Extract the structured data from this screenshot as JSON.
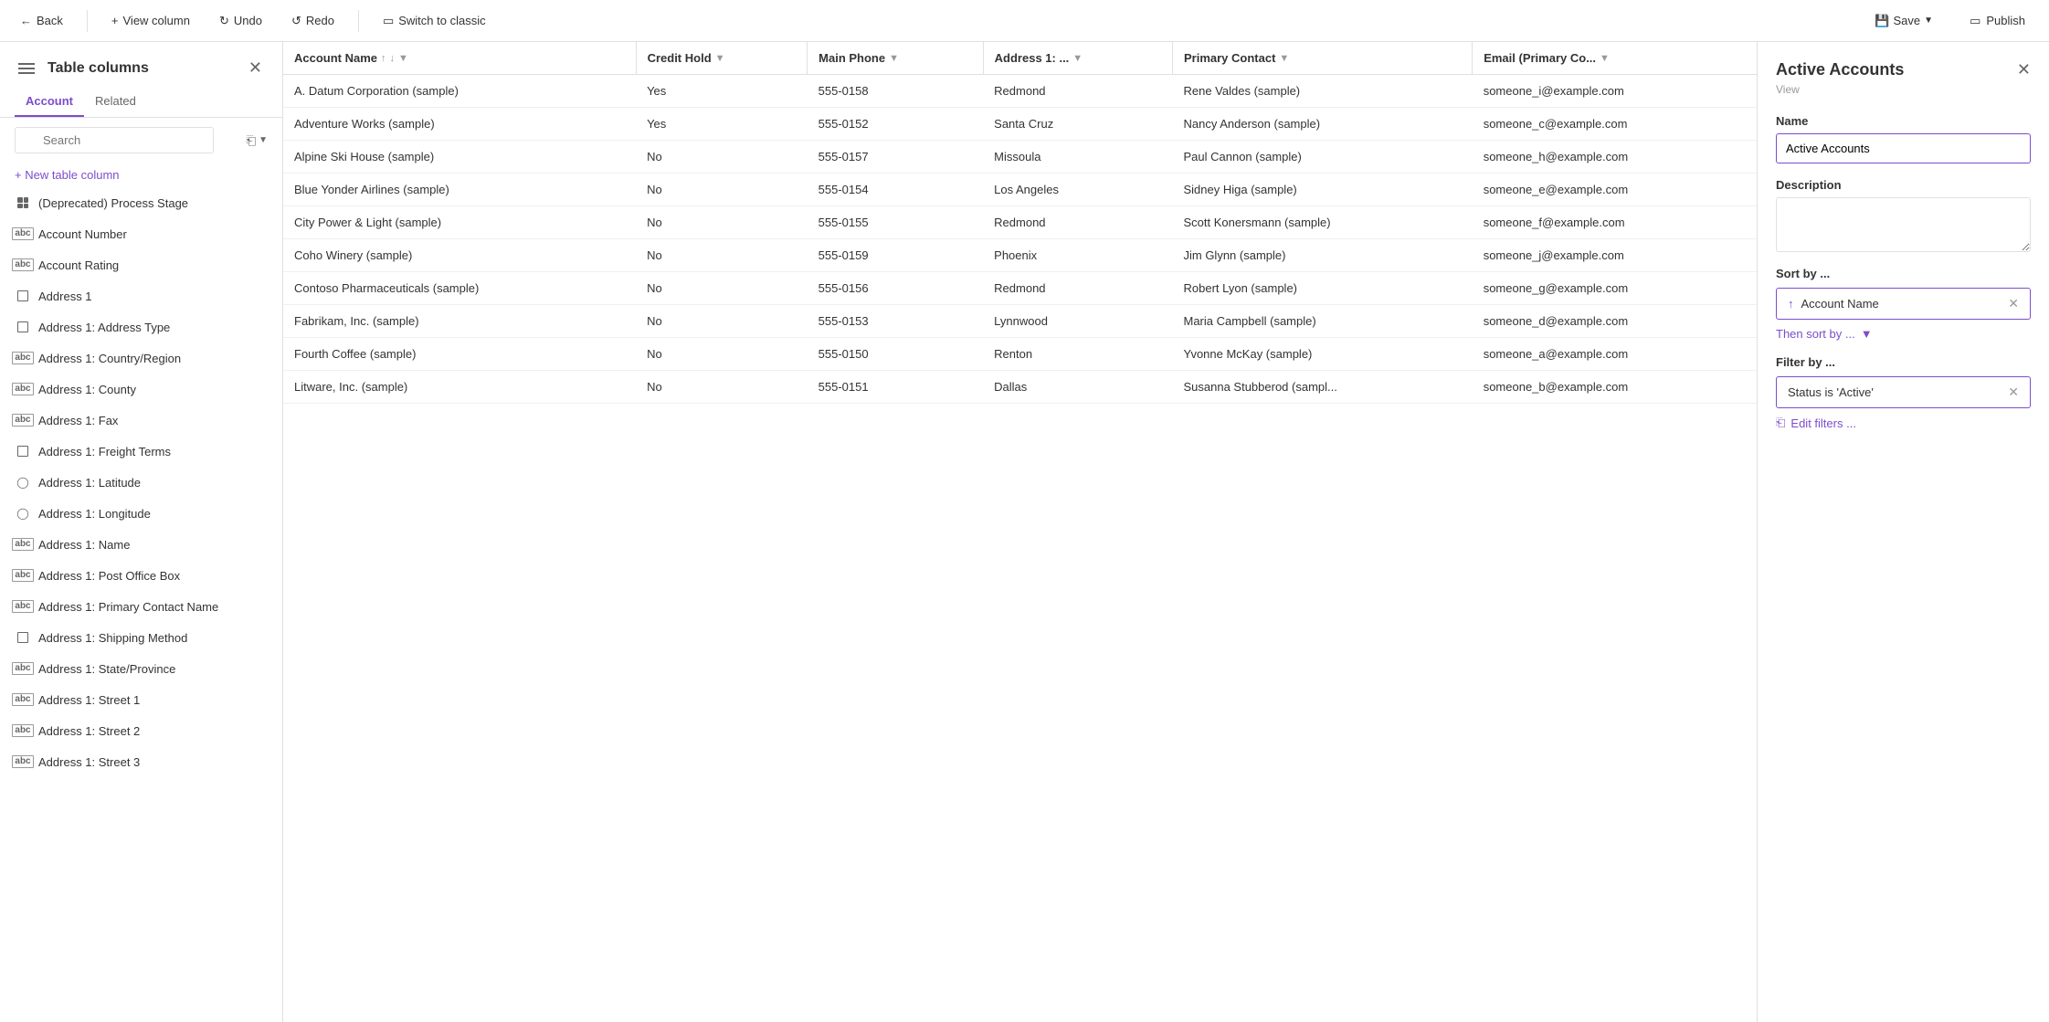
{
  "topbar": {
    "back_label": "Back",
    "view_column_label": "View column",
    "undo_label": "Undo",
    "redo_label": "Redo",
    "switch_label": "Switch to classic",
    "save_label": "Save",
    "publish_label": "Publish"
  },
  "left_panel": {
    "title": "Table columns",
    "tab_account": "Account",
    "tab_related": "Related",
    "search_placeholder": "Search",
    "new_column_label": "+ New table column",
    "columns": [
      {
        "id": "deprecated",
        "name": "(Deprecated) Process Stage",
        "icon": "grid"
      },
      {
        "id": "acct_number",
        "name": "Account Number",
        "icon": "abc"
      },
      {
        "id": "acct_rating",
        "name": "Account Rating",
        "icon": "abc"
      },
      {
        "id": "addr1",
        "name": "Address 1",
        "icon": "box"
      },
      {
        "id": "addr1_type",
        "name": "Address 1: Address Type",
        "icon": "box"
      },
      {
        "id": "addr1_country",
        "name": "Address 1: Country/Region",
        "icon": "abc"
      },
      {
        "id": "addr1_county",
        "name": "Address 1: County",
        "icon": "abc"
      },
      {
        "id": "addr1_fax",
        "name": "Address 1: Fax",
        "icon": "abc"
      },
      {
        "id": "addr1_freight",
        "name": "Address 1: Freight Terms",
        "icon": "box"
      },
      {
        "id": "addr1_lat",
        "name": "Address 1: Latitude",
        "icon": "circle"
      },
      {
        "id": "addr1_lon",
        "name": "Address 1: Longitude",
        "icon": "circle"
      },
      {
        "id": "addr1_name",
        "name": "Address 1: Name",
        "icon": "abc"
      },
      {
        "id": "addr1_po",
        "name": "Address 1: Post Office Box",
        "icon": "abc"
      },
      {
        "id": "addr1_primary",
        "name": "Address 1: Primary Contact Name",
        "icon": "abc"
      },
      {
        "id": "addr1_shipping",
        "name": "Address 1: Shipping Method",
        "icon": "box"
      },
      {
        "id": "addr1_state",
        "name": "Address 1: State/Province",
        "icon": "abc"
      },
      {
        "id": "addr1_street1",
        "name": "Address 1: Street 1",
        "icon": "abc"
      },
      {
        "id": "addr1_street2",
        "name": "Address 1: Street 2",
        "icon": "abc"
      },
      {
        "id": "addr1_street3",
        "name": "Address 1: Street 3",
        "icon": "abc"
      }
    ]
  },
  "table": {
    "columns": [
      {
        "id": "account_name",
        "label": "Account Name",
        "sortable": true,
        "filterable": true
      },
      {
        "id": "credit_hold",
        "label": "Credit Hold",
        "sortable": false,
        "filterable": true
      },
      {
        "id": "main_phone",
        "label": "Main Phone",
        "sortable": false,
        "filterable": true
      },
      {
        "id": "address1",
        "label": "Address 1: ...",
        "sortable": false,
        "filterable": true
      },
      {
        "id": "primary_contact",
        "label": "Primary Contact",
        "sortable": false,
        "filterable": true
      },
      {
        "id": "email",
        "label": "Email (Primary Co...",
        "sortable": false,
        "filterable": true
      }
    ],
    "rows": [
      {
        "account_name": "A. Datum Corporation (sample)",
        "credit_hold": "Yes",
        "main_phone": "555-0158",
        "address1": "Redmond",
        "primary_contact": "Rene Valdes (sample)",
        "email": "someone_i@example.com"
      },
      {
        "account_name": "Adventure Works (sample)",
        "credit_hold": "Yes",
        "main_phone": "555-0152",
        "address1": "Santa Cruz",
        "primary_contact": "Nancy Anderson (sample)",
        "email": "someone_c@example.com"
      },
      {
        "account_name": "Alpine Ski House (sample)",
        "credit_hold": "No",
        "main_phone": "555-0157",
        "address1": "Missoula",
        "primary_contact": "Paul Cannon (sample)",
        "email": "someone_h@example.com"
      },
      {
        "account_name": "Blue Yonder Airlines (sample)",
        "credit_hold": "No",
        "main_phone": "555-0154",
        "address1": "Los Angeles",
        "primary_contact": "Sidney Higa (sample)",
        "email": "someone_e@example.com"
      },
      {
        "account_name": "City Power & Light (sample)",
        "credit_hold": "No",
        "main_phone": "555-0155",
        "address1": "Redmond",
        "primary_contact": "Scott Konersmann (sample)",
        "email": "someone_f@example.com"
      },
      {
        "account_name": "Coho Winery (sample)",
        "credit_hold": "No",
        "main_phone": "555-0159",
        "address1": "Phoenix",
        "primary_contact": "Jim Glynn (sample)",
        "email": "someone_j@example.com"
      },
      {
        "account_name": "Contoso Pharmaceuticals (sample)",
        "credit_hold": "No",
        "main_phone": "555-0156",
        "address1": "Redmond",
        "primary_contact": "Robert Lyon (sample)",
        "email": "someone_g@example.com"
      },
      {
        "account_name": "Fabrikam, Inc. (sample)",
        "credit_hold": "No",
        "main_phone": "555-0153",
        "address1": "Lynnwood",
        "primary_contact": "Maria Campbell (sample)",
        "email": "someone_d@example.com"
      },
      {
        "account_name": "Fourth Coffee (sample)",
        "credit_hold": "No",
        "main_phone": "555-0150",
        "address1": "Renton",
        "primary_contact": "Yvonne McKay (sample)",
        "email": "someone_a@example.com"
      },
      {
        "account_name": "Litware, Inc. (sample)",
        "credit_hold": "No",
        "main_phone": "555-0151",
        "address1": "Dallas",
        "primary_contact": "Susanna Stubberod (sampl...",
        "email": "someone_b@example.com"
      }
    ]
  },
  "right_panel": {
    "title": "Active Accounts",
    "view_label": "View",
    "name_label": "Name",
    "name_value": "Active Accounts",
    "description_label": "Description",
    "description_value": "",
    "sort_label": "Sort by ...",
    "sort_field": "Account Name",
    "then_sort_label": "Then sort by ...",
    "filter_label": "Filter by ...",
    "filter_value": "Status is 'Active'",
    "edit_filters_label": "Edit filters ..."
  }
}
